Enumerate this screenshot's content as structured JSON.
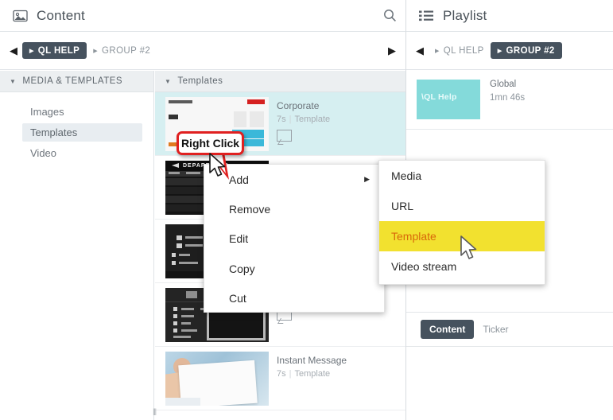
{
  "content_panel": {
    "title": "Content",
    "title_icon": "image-icon",
    "search_icon": "search-icon",
    "breadcrumb": {
      "back_arrow": "left-arrow-icon",
      "forward_arrow": "right-arrow-icon",
      "items": [
        {
          "label": "QL HELP",
          "active": true
        },
        {
          "label": "GROUP #2",
          "active": false
        }
      ]
    },
    "nav_section": {
      "header": "MEDIA & TEMPLATES",
      "caret_icon": "caret-down-icon",
      "items": [
        {
          "label": "Images",
          "selected": false
        },
        {
          "label": "Templates",
          "selected": true
        },
        {
          "label": "Video",
          "selected": false
        }
      ]
    },
    "templates_section": {
      "header": "Templates",
      "caret_icon": "caret-down-icon",
      "items": [
        {
          "name": "Corporate",
          "duration": "7s",
          "type": "Template",
          "selected": true,
          "thumb": "corporate",
          "has_bubble": true
        },
        {
          "name": "",
          "duration": "",
          "type": "",
          "selected": false,
          "thumb": "departures",
          "has_bubble": false
        },
        {
          "name": "",
          "duration": "",
          "type": "",
          "selected": false,
          "thumb": "menu-board",
          "has_bubble": false
        },
        {
          "name": "",
          "duration": "",
          "type": "",
          "selected": false,
          "thumb": "screen-dark",
          "has_bubble": true
        },
        {
          "name": "Instant Message",
          "duration": "7s",
          "type": "Template",
          "selected": false,
          "thumb": "hand-card",
          "has_bubble": false
        }
      ]
    },
    "resize_handle": "⦀"
  },
  "playlist_panel": {
    "title": "Playlist",
    "title_icon": "list-grid-icon",
    "breadcrumb": {
      "back_arrow": "left-arrow-icon",
      "items": [
        {
          "label": "QL HELP",
          "active": false
        },
        {
          "label": "GROUP #2",
          "active": true
        }
      ]
    },
    "items": [
      {
        "thumb_label": "\\QL Help",
        "name": "Global",
        "duration": "1mn 46s"
      }
    ],
    "tabs": [
      {
        "label": "Content",
        "active": true
      },
      {
        "label": "Ticker",
        "active": false
      }
    ]
  },
  "context_menu": {
    "items": [
      {
        "label": "Add",
        "has_submenu": true
      },
      {
        "label": "Remove",
        "has_submenu": false
      },
      {
        "label": "Edit",
        "has_submenu": false
      },
      {
        "label": "Copy",
        "has_submenu": false
      },
      {
        "label": "Cut",
        "has_submenu": false
      }
    ],
    "submenu_arrow": "▶"
  },
  "submenu": {
    "items": [
      {
        "label": "Media",
        "highlighted": false
      },
      {
        "label": "URL",
        "highlighted": false
      },
      {
        "label": "Template",
        "highlighted": true
      },
      {
        "label": "Video stream",
        "highlighted": false
      }
    ]
  },
  "annotation": {
    "callout_text": "Right Click",
    "callout_border_color": "#e02020"
  },
  "colors": {
    "breadcrumb_active_bg": "#46525e",
    "selected_row_bg": "#d6eff1",
    "playlist_thumb_bg": "#84dada",
    "submenu_highlight_bg": "#f2e12f",
    "submenu_highlight_text": "#d8680a",
    "nav_selected_bg": "#e8edf1",
    "section_header_bg": "#eceff1"
  }
}
